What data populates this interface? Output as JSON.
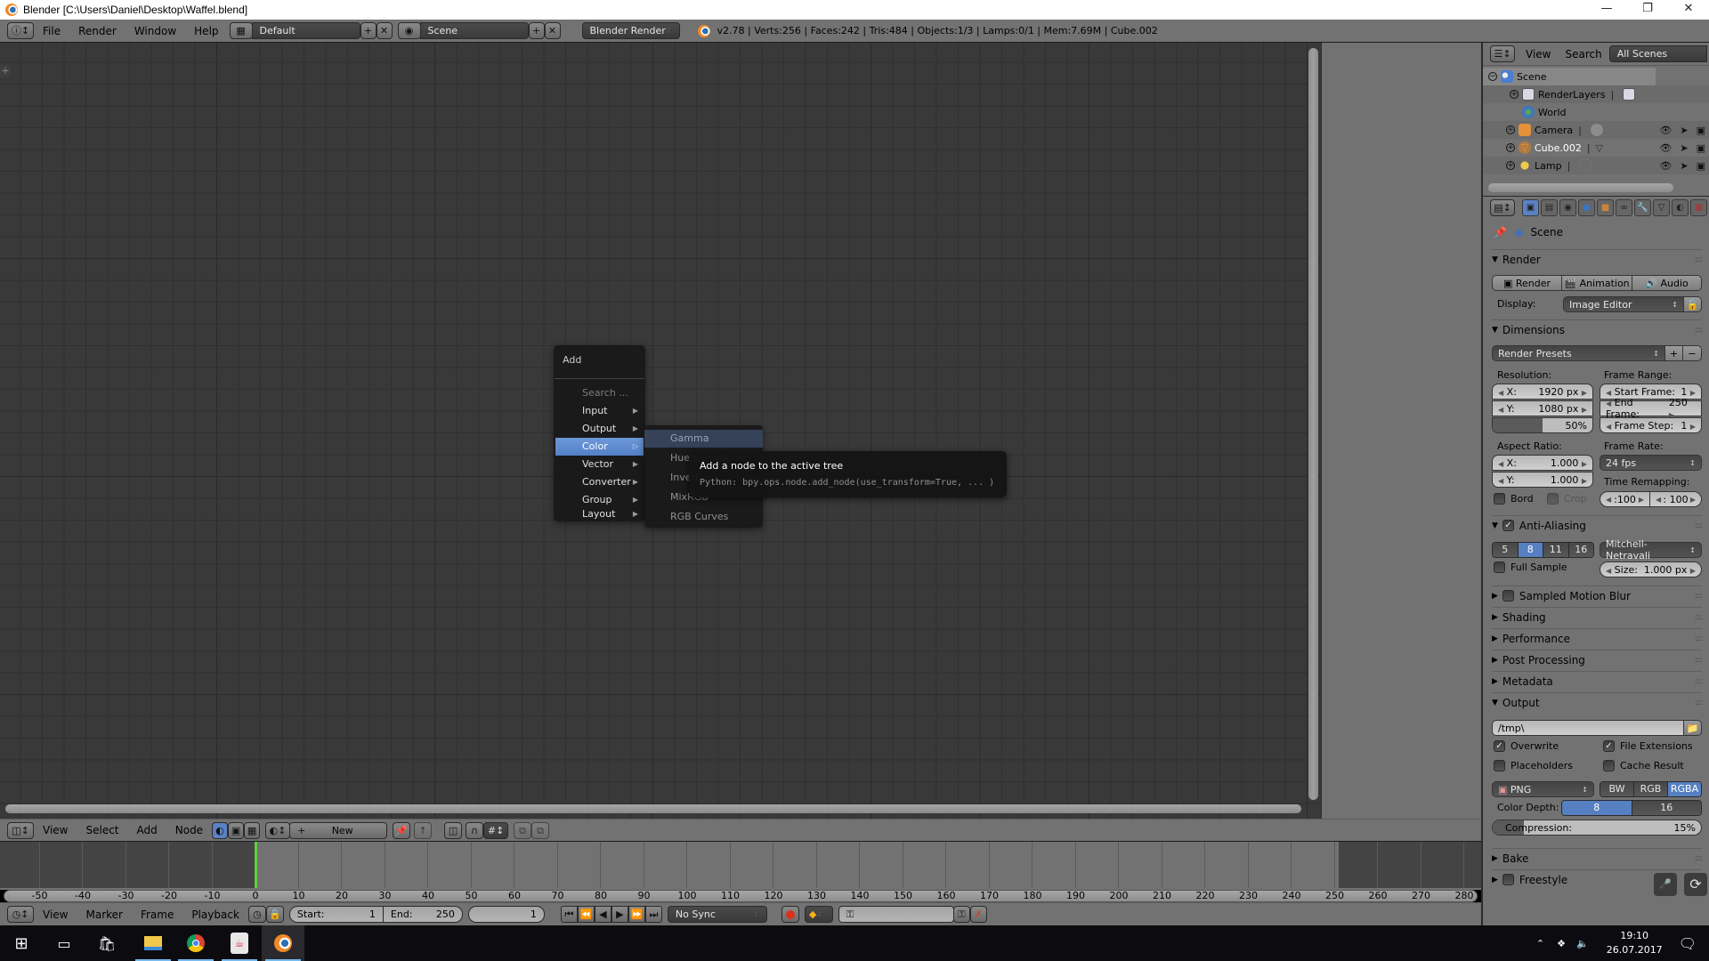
{
  "window": {
    "title": "Blender [C:\\Users\\Daniel\\Desktop\\Waffel.blend]",
    "controls": [
      "minimize",
      "maximize",
      "close"
    ]
  },
  "info_header": {
    "menus": [
      "File",
      "Render",
      "Window",
      "Help"
    ],
    "layout": "Default",
    "scene": "Scene",
    "engine": "Blender Render",
    "stats": "v2.78 | Verts:256 | Faces:242 | Tris:484 | Objects:1/3 | Lamps:0/1 | Mem:7.69M | Cube.002"
  },
  "add_menu": {
    "title": "Add",
    "search_placeholder": "Search ...",
    "items": [
      "Input",
      "Output",
      "Color",
      "Vector",
      "Converter",
      "Group",
      "Layout"
    ],
    "highlighted": "Color",
    "color_submenu": [
      "Gamma",
      "Hue/Saturation",
      "Invert",
      "MixRGB",
      "RGB Curves"
    ],
    "tooltip": {
      "title": "Add a node to the active tree",
      "python": "Python: bpy.ops.node.add_node(use_transform=True, ... )"
    }
  },
  "node_header": {
    "menus": [
      "View",
      "Select",
      "Add",
      "Node"
    ],
    "new_label": "New"
  },
  "timeline": {
    "ruler_ticks": [
      -50,
      -40,
      -30,
      -20,
      -10,
      0,
      10,
      20,
      30,
      40,
      50,
      60,
      70,
      80,
      90,
      100,
      110,
      120,
      130,
      140,
      150,
      160,
      170,
      180,
      190,
      200,
      210,
      220,
      230,
      240,
      250,
      260,
      270,
      280
    ],
    "current_frame": 1,
    "menus": [
      "View",
      "Marker",
      "Frame",
      "Playback"
    ],
    "start_label": "Start:",
    "start": "1",
    "end_label": "End:",
    "end": "250",
    "frame": "1",
    "sync": "No Sync"
  },
  "outliner": {
    "menus": [
      "View",
      "Search"
    ],
    "filter": "All Scenes",
    "rows": [
      {
        "name": "Scene",
        "icon": "scene-icon"
      },
      {
        "name": "RenderLayers",
        "icon": "renderlayers-icon"
      },
      {
        "name": "World",
        "icon": "world-icon"
      },
      {
        "name": "Camera",
        "icon": "camera-icon"
      },
      {
        "name": "Cube.002",
        "icon": "mesh-icon"
      },
      {
        "name": "Lamp",
        "icon": "lamp-icon"
      }
    ]
  },
  "properties": {
    "context": "Scene",
    "render": {
      "title": "Render",
      "buttons": [
        "Render",
        "Animation",
        "Audio"
      ],
      "display_label": "Display:",
      "display": "Image Editor"
    },
    "dimensions": {
      "title": "Dimensions",
      "presets": "Render Presets",
      "resolution_label": "Resolution:",
      "res_x_label": "X:",
      "res_x": "1920 px",
      "res_y_label": "Y:",
      "res_y": "1080 px",
      "res_percent": "50%",
      "res_percent_value": 0.5,
      "aspect_label": "Aspect Ratio:",
      "aspect_x": "1.000",
      "aspect_y": "1.000",
      "bord": "Bord",
      "crop": "Crop",
      "frame_range_label": "Frame Range:",
      "start_frame_label": "Start Frame:",
      "start_frame": "1",
      "end_frame_label": "End Frame:",
      "end_frame": "250",
      "frame_step_label": "Frame Step:",
      "frame_step": "1",
      "frame_rate_label": "Frame Rate:",
      "frame_rate": "24 fps",
      "time_remap_label": "Time Remapping:",
      "remap_old": ":100",
      "remap_new": ": 100"
    },
    "anti_aliasing": {
      "title": "Anti-Aliasing",
      "samples": [
        "5",
        "8",
        "11",
        "16"
      ],
      "selected": "8",
      "filter": "Mitchell-Netravali",
      "full_sample": "Full Sample",
      "size_label": "Size:",
      "size": "1.000 px"
    },
    "collapsed_panels": [
      "Sampled Motion Blur",
      "Shading",
      "Performance",
      "Post Processing",
      "Metadata"
    ],
    "output": {
      "title": "Output",
      "path": "/tmp\\",
      "overwrite": "Overwrite",
      "file_extensions": "File Extensions",
      "placeholders": "Placeholders",
      "cache_result": "Cache Result",
      "format": "PNG",
      "color_modes": [
        "BW",
        "RGB",
        "RGBA"
      ],
      "color_mode_selected": "RGBA",
      "color_depth_label": "Color Depth:",
      "depths": [
        "8",
        "16"
      ],
      "depth_selected": "8",
      "compression_label": "Compression:",
      "compression": "15%",
      "compression_value": 0.15
    },
    "bottom_panels": [
      "Bake",
      "Freestyle"
    ]
  },
  "taskbar": {
    "apps": [
      "start",
      "task-view",
      "store",
      "file-explorer",
      "chrome",
      "java",
      "blender"
    ],
    "time": "19:10",
    "date": "26.07.2017"
  }
}
